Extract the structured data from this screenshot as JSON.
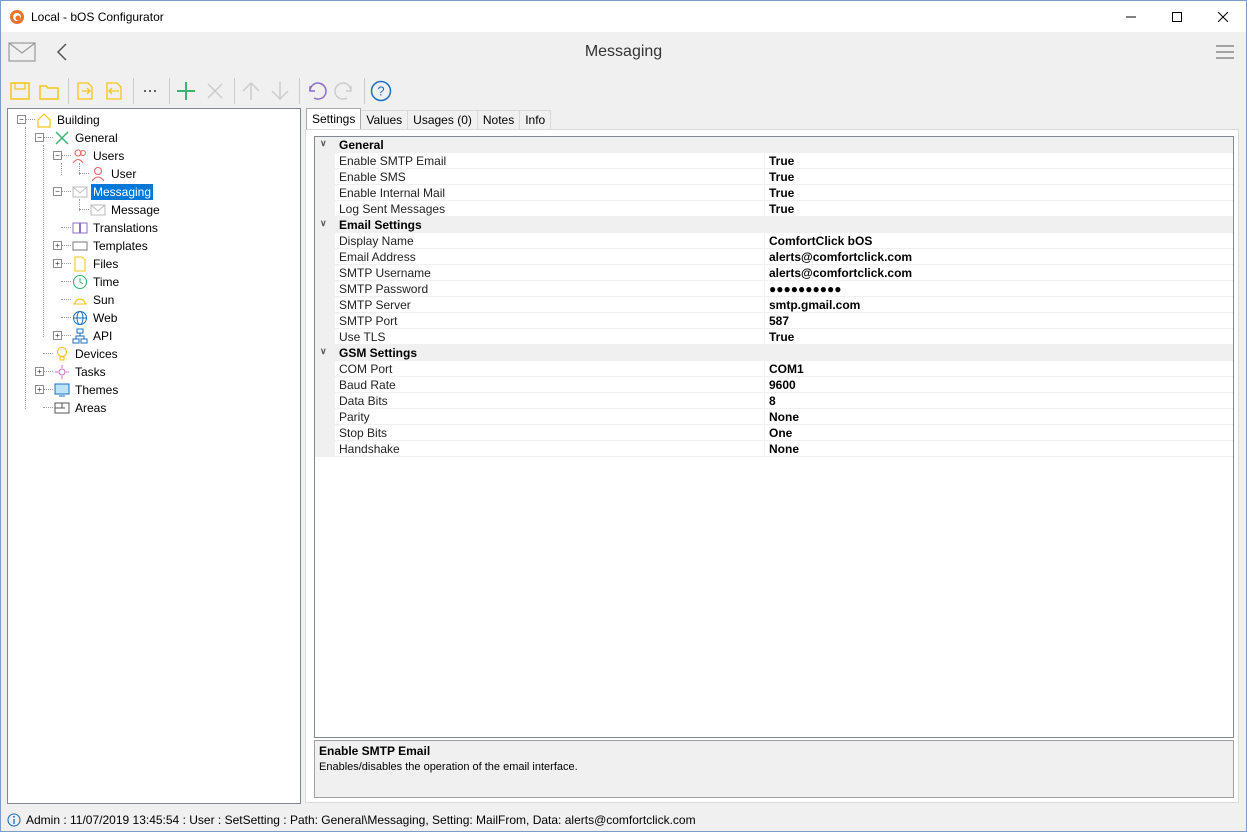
{
  "window": {
    "title": "Local - bOS Configurator"
  },
  "header": {
    "title": "Messaging"
  },
  "tree": {
    "items": [
      {
        "label": "Building"
      },
      {
        "label": "General"
      },
      {
        "label": "Users"
      },
      {
        "label": "User"
      },
      {
        "label": "Messaging"
      },
      {
        "label": "Message"
      },
      {
        "label": "Translations"
      },
      {
        "label": "Templates"
      },
      {
        "label": "Files"
      },
      {
        "label": "Time"
      },
      {
        "label": "Sun"
      },
      {
        "label": "Web"
      },
      {
        "label": "API"
      },
      {
        "label": "Devices"
      },
      {
        "label": "Tasks"
      },
      {
        "label": "Themes"
      },
      {
        "label": "Areas"
      }
    ]
  },
  "tabs": [
    {
      "label": "Settings"
    },
    {
      "label": "Values"
    },
    {
      "label": "Usages (0)"
    },
    {
      "label": "Notes"
    },
    {
      "label": "Info"
    }
  ],
  "grid": {
    "categories": [
      {
        "label": "General",
        "rows": [
          {
            "name": "Enable SMTP Email",
            "value": "True"
          },
          {
            "name": "Enable SMS",
            "value": "True"
          },
          {
            "name": "Enable Internal Mail",
            "value": "True"
          },
          {
            "name": "Log Sent Messages",
            "value": "True"
          }
        ]
      },
      {
        "label": "Email Settings",
        "rows": [
          {
            "name": "Display Name",
            "value": "ComfortClick bOS"
          },
          {
            "name": "Email Address",
            "value": "alerts@comfortclick.com"
          },
          {
            "name": "SMTP Username",
            "value": "alerts@comfortclick.com"
          },
          {
            "name": "SMTP Password",
            "value": "●●●●●●●●●●"
          },
          {
            "name": "SMTP Server",
            "value": "smtp.gmail.com"
          },
          {
            "name": "SMTP Port",
            "value": "587"
          },
          {
            "name": "Use TLS",
            "value": "True"
          }
        ]
      },
      {
        "label": "GSM Settings",
        "rows": [
          {
            "name": "COM Port",
            "value": "COM1"
          },
          {
            "name": "Baud Rate",
            "value": "9600"
          },
          {
            "name": "Data Bits",
            "value": "8"
          },
          {
            "name": "Parity",
            "value": "None"
          },
          {
            "name": "Stop Bits",
            "value": "One"
          },
          {
            "name": "Handshake",
            "value": "None"
          }
        ]
      }
    ]
  },
  "description": {
    "title": "Enable SMTP Email",
    "text": "Enables/disables the operation of the email interface."
  },
  "status": {
    "text": "Admin : 11/07/2019 13:45:54 : User : SetSetting : Path: General\\Messaging, Setting: MailFrom, Data: alerts@comfortclick.com"
  },
  "colors": {
    "selection": "#0078d7",
    "accent_yellow": "#f5c518",
    "accent_green": "#3cb371",
    "help_blue": "#1e6fbf"
  }
}
